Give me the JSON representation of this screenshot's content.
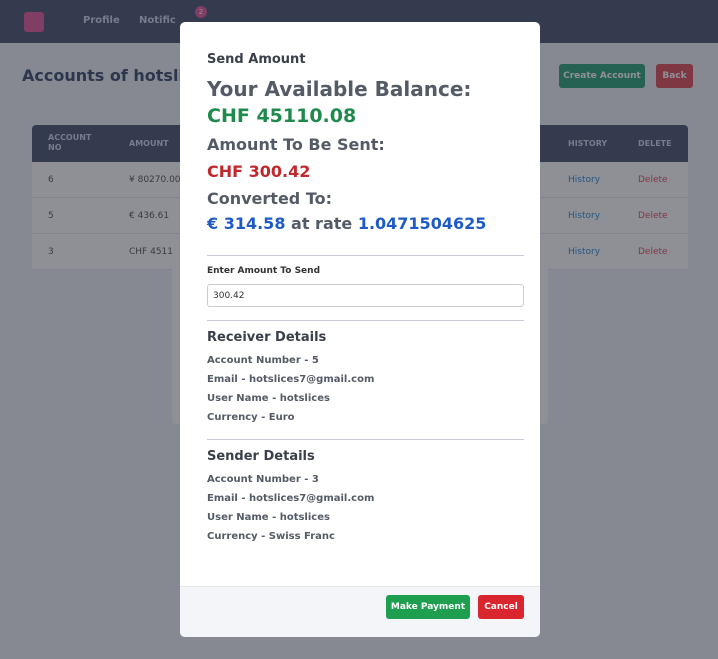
{
  "navbar": {
    "links": [
      "Profile",
      "Notific"
    ],
    "badge_count": "2"
  },
  "page": {
    "title": "Accounts of hotslices",
    "create_label": "Create Account",
    "back_label": "Back"
  },
  "table": {
    "headers": [
      "ACCOUNT NO",
      "AMOUNT",
      "HISTORY",
      "DELETE"
    ],
    "rows": [
      {
        "account_no": "6",
        "amount": "¥ 80270.00",
        "history": "History",
        "delete": "Delete"
      },
      {
        "account_no": "5",
        "amount": "€ 436.61",
        "history": "History",
        "delete": "Delete"
      },
      {
        "account_no": "3",
        "amount": "CHF 4511",
        "history": "History",
        "delete": "Delete"
      }
    ]
  },
  "modal": {
    "title": "Send Amount",
    "balance_heading": "Your Available Balance:",
    "balance_value": "CHF 45110.08",
    "sent_heading": "Amount To Be Sent:",
    "sent_value": "CHF 300.42",
    "converted_heading": "Converted To:",
    "converted_amount": "€ 314.58",
    "rate_text": "at rate",
    "rate_value": "1.0471504625",
    "input_label": "Enter Amount To Send",
    "input_value": "300.42",
    "receiver": {
      "heading": "Receiver Details",
      "account": "Account Number - 5",
      "email": "Email - hotslices7@gmail.com",
      "username": "User Name - hotslices",
      "currency": "Currency - Euro"
    },
    "sender": {
      "heading": "Sender Details",
      "account": "Account Number - 3",
      "email": "Email - hotslices7@gmail.com",
      "username": "User Name - hotslices",
      "currency": "Currency - Swiss Franc"
    },
    "pay_label": "Make Payment",
    "cancel_label": "Cancel"
  },
  "colors": {
    "balance": "#1e8b4c",
    "sent": "#c0282e",
    "converted": "#1f5bc7",
    "pay_button": "#1e9e4f",
    "cancel_button": "#d9262e"
  }
}
